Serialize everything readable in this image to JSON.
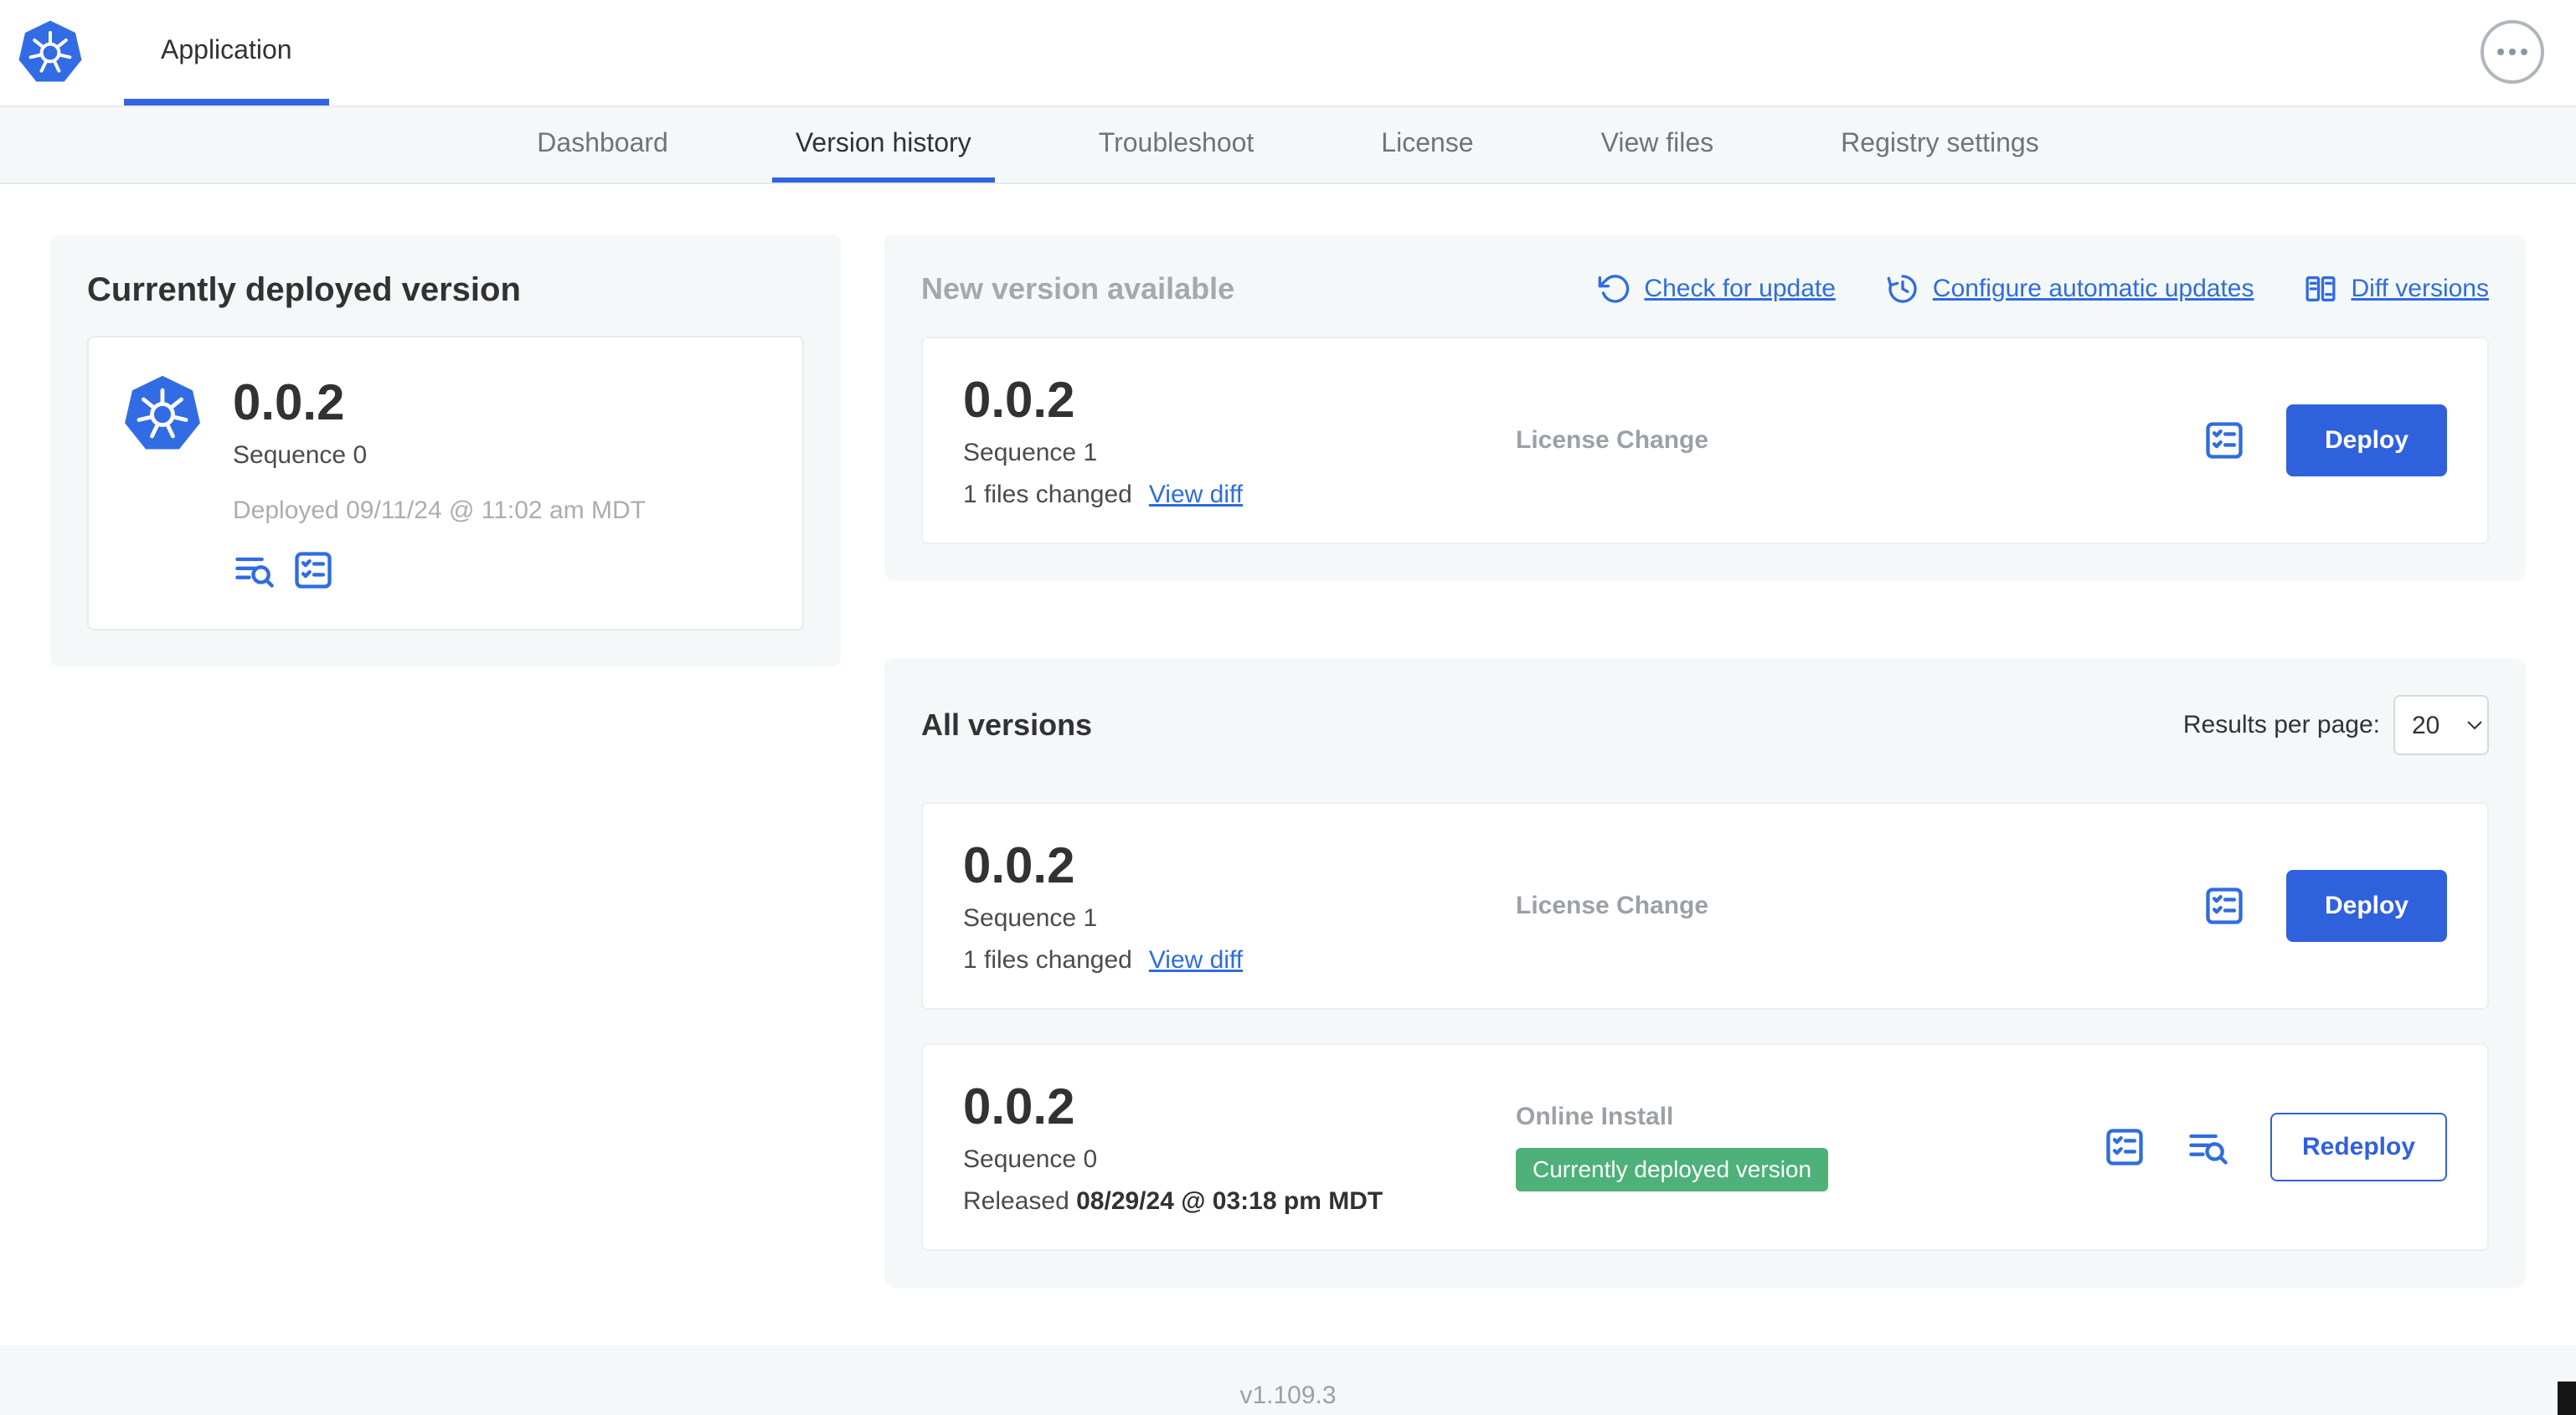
{
  "header": {
    "app_tab": "Application"
  },
  "nav": {
    "active_tab": "Version history",
    "tabs": [
      {
        "label": "Dashboard"
      },
      {
        "label": "Version history"
      },
      {
        "label": "Troubleshoot"
      },
      {
        "label": "License"
      },
      {
        "label": "View files"
      },
      {
        "label": "Registry settings"
      }
    ]
  },
  "current_version": {
    "title": "Currently deployed version",
    "version": "0.0.2",
    "sequence": "Sequence 0",
    "deployed": "Deployed 09/11/24 @ 11:02 am MDT"
  },
  "new_version": {
    "title": "New version available",
    "check_for_update": "Check for update",
    "configure_updates": "Configure automatic updates",
    "diff_versions": "Diff versions",
    "card": {
      "version": "0.0.2",
      "sequence": "Sequence 1",
      "files_changed": "1 files changed",
      "view_diff": "View diff",
      "source": "License Change",
      "action": "Deploy"
    }
  },
  "all_versions": {
    "title": "All versions",
    "results_per_page_label": "Results per page:",
    "results_per_page_value": "20",
    "rows": [
      {
        "version": "0.0.2",
        "sequence": "Sequence 1",
        "files_changed": "1 files changed",
        "view_diff": "View diff",
        "source": "License Change",
        "action": "Deploy"
      },
      {
        "version": "0.0.2",
        "sequence": "Sequence 0",
        "released_label": "Released",
        "released_date": "08/29/24 @ 03:18 pm MDT",
        "source": "Online Install",
        "badge": "Currently deployed version",
        "action": "Redeploy"
      }
    ]
  },
  "footer": {
    "app_version": "v1.109.3"
  },
  "colors": {
    "accent_blue": "#3066e0",
    "badge_green": "#4db179",
    "panel_gray": "#f5f8f9",
    "kubernetes_blue": "#326ce5"
  }
}
